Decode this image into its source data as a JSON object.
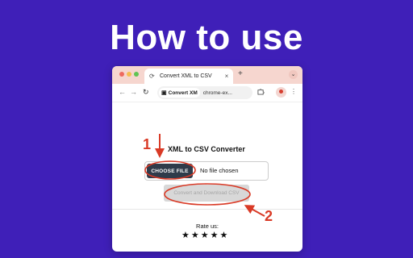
{
  "headline": "How to use",
  "browser": {
    "tab_title": "Convert XML to CSV",
    "tab_close": "×",
    "new_tab": "+",
    "tab_menu": "⌄",
    "nav_back": "←",
    "nav_forward": "→",
    "nav_reload": "↻",
    "omnibox_chip": "Convert XM",
    "omnibox_url": "chrome-ex...",
    "more_menu": "⋮"
  },
  "app": {
    "title": "XML to CSV Converter",
    "choose_file_label": "CHOOSE FILE",
    "no_file_text": "No file chosen",
    "convert_label": "Convert and Download CSV",
    "rate_label": "Rate us:",
    "stars": [
      "★",
      "★",
      "★",
      "★",
      "★"
    ]
  },
  "callouts": {
    "step1": "1",
    "step2": "2",
    "color": "#d93a26"
  },
  "colors": {
    "background": "#3f1fb8",
    "tabbar": "#f6d6cf",
    "choose_button": "#2f3b4a"
  }
}
